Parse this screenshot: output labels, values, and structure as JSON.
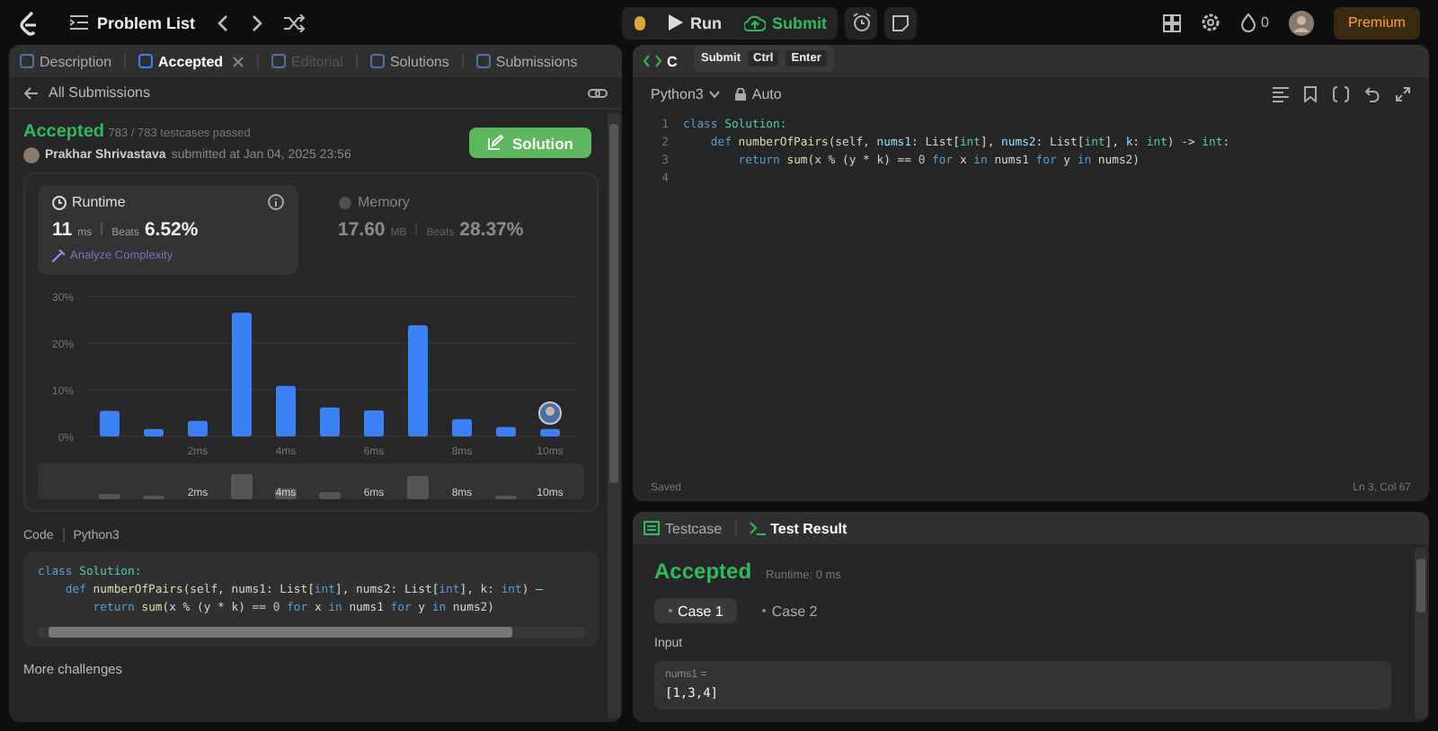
{
  "topbar": {
    "problem_list": "Problem List",
    "run": "Run",
    "submit": "Submit",
    "streak": "0",
    "premium": "Premium"
  },
  "tooltip": {
    "label": "Submit",
    "keys": [
      "Ctrl",
      "Enter"
    ]
  },
  "left_tabs": [
    {
      "label": "Description",
      "selected": false,
      "disabled": false,
      "closable": false
    },
    {
      "label": "Accepted",
      "selected": true,
      "disabled": false,
      "closable": true
    },
    {
      "label": "Editorial",
      "selected": false,
      "disabled": true,
      "closable": false
    },
    {
      "label": "Solutions",
      "selected": false,
      "disabled": false,
      "closable": false
    },
    {
      "label": "Submissions",
      "selected": false,
      "disabled": false,
      "closable": false
    }
  ],
  "back_link": "All Submissions",
  "submission": {
    "status": "Accepted",
    "passed": "783 / 783 testcases passed",
    "author": "Prakhar Shrivastava",
    "submitted": "submitted at Jan 04, 2025 23:56",
    "solution_button": "Solution"
  },
  "runtime": {
    "title": "Runtime",
    "value": "11",
    "unit": "ms",
    "beats_label": "Beats",
    "beats": "6.52%",
    "analyze": "Analyze Complexity",
    "selected": true
  },
  "memory": {
    "title": "Memory",
    "value": "17.60",
    "unit": "MB",
    "beats_label": "Beats",
    "beats": "28.37%",
    "selected": false
  },
  "chart_data": {
    "type": "bar",
    "categories": [
      null,
      null,
      "2ms",
      null,
      "4ms",
      null,
      "6ms",
      null,
      "8ms",
      null,
      "10ms"
    ],
    "values": [
      5.5,
      1.6,
      3.3,
      26.5,
      10.8,
      6.2,
      5.6,
      23.8,
      3.7,
      2.0,
      1.6
    ],
    "ylim": [
      0,
      30
    ],
    "yticks": [
      {
        "value": 0,
        "label": "0%"
      },
      {
        "value": 10,
        "label": "10%"
      },
      {
        "value": 20,
        "label": "20%"
      },
      {
        "value": 30,
        "label": "30%"
      }
    ]
  },
  "overview_labels": [
    "2ms",
    "4ms",
    "6ms",
    "8ms",
    "10ms"
  ],
  "code_section": {
    "label": "Code",
    "language": "Python3"
  },
  "submitted_code": [
    [
      {
        "t": "class ",
        "kind": "kw"
      },
      {
        "t": "Solution:",
        "kind": "cls"
      }
    ],
    [
      {
        "t": "    def ",
        "kind": "kw"
      },
      {
        "t": "numberOfPairs",
        "kind": "fn"
      },
      {
        "t": "(self, nums1: List[",
        "kind": "p"
      },
      {
        "t": "int",
        "kind": "kw"
      },
      {
        "t": "], nums2: List[",
        "kind": "p"
      },
      {
        "t": "int",
        "kind": "kw"
      },
      {
        "t": "], k: ",
        "kind": "p"
      },
      {
        "t": "int",
        "kind": "kw"
      },
      {
        "t": ") –",
        "kind": "p"
      }
    ],
    [
      {
        "t": "        return ",
        "kind": "kw"
      },
      {
        "t": "sum",
        "kind": "fn"
      },
      {
        "t": "(x % (y * k) == ",
        "kind": "p"
      },
      {
        "t": "0",
        "kind": "num"
      },
      {
        "t": " for ",
        "kind": "kw"
      },
      {
        "t": "x ",
        "kind": "p"
      },
      {
        "t": "in ",
        "kind": "kw"
      },
      {
        "t": "nums1 ",
        "kind": "p"
      },
      {
        "t": "for ",
        "kind": "kw"
      },
      {
        "t": "y ",
        "kind": "p"
      },
      {
        "t": "in ",
        "kind": "kw"
      },
      {
        "t": "nums2)",
        "kind": "p"
      }
    ]
  ],
  "more_challenges": "More challenges",
  "editor": {
    "tab": "C",
    "language": "Python3",
    "mode": "Auto",
    "status": "Saved",
    "position": "Ln 3, Col 67",
    "line_numbers": [
      "1",
      "2",
      "3",
      "4"
    ],
    "lines": [
      [
        {
          "t": "class ",
          "kind": "kw"
        },
        {
          "t": "Solution:",
          "kind": "cls"
        }
      ],
      [
        {
          "t": "    def ",
          "kind": "kw"
        },
        {
          "t": "numberOfPairs",
          "kind": "fn"
        },
        {
          "t": "(self, ",
          "kind": "p"
        },
        {
          "t": "nums1",
          "kind": "var"
        },
        {
          "t": ": List[",
          "kind": "p"
        },
        {
          "t": "int",
          "kind": "cls"
        },
        {
          "t": "], ",
          "kind": "p"
        },
        {
          "t": "nums2",
          "kind": "var"
        },
        {
          "t": ": List[",
          "kind": "p"
        },
        {
          "t": "int",
          "kind": "cls"
        },
        {
          "t": "], ",
          "kind": "p"
        },
        {
          "t": "k",
          "kind": "var"
        },
        {
          "t": ": ",
          "kind": "p"
        },
        {
          "t": "int",
          "kind": "cls"
        },
        {
          "t": ") -> ",
          "kind": "p"
        },
        {
          "t": "int",
          "kind": "cls"
        },
        {
          "t": ":",
          "kind": "p"
        }
      ],
      [
        {
          "t": "        return ",
          "kind": "kw"
        },
        {
          "t": "sum",
          "kind": "fn"
        },
        {
          "t": "(x % (y * k) == ",
          "kind": "p"
        },
        {
          "t": "0",
          "kind": "num"
        },
        {
          "t": " for ",
          "kind": "kw"
        },
        {
          "t": "x ",
          "kind": "p"
        },
        {
          "t": "in ",
          "kind": "kw"
        },
        {
          "t": "nums1 ",
          "kind": "p"
        },
        {
          "t": "for ",
          "kind": "kw"
        },
        {
          "t": "y ",
          "kind": "p"
        },
        {
          "t": "in ",
          "kind": "kw"
        },
        {
          "t": "nums2)",
          "kind": "p"
        }
      ]
    ]
  },
  "test_tabs": [
    {
      "label": "Testcase",
      "selected": false
    },
    {
      "label": "Test Result",
      "selected": true
    }
  ],
  "result": {
    "status": "Accepted",
    "runtime": "Runtime: 0 ms",
    "cases": [
      {
        "label": "Case 1",
        "selected": true
      },
      {
        "label": "Case 2",
        "selected": false
      }
    ],
    "input_label": "Input",
    "param_name": "nums1 =",
    "param_value": "[1,3,4]"
  }
}
